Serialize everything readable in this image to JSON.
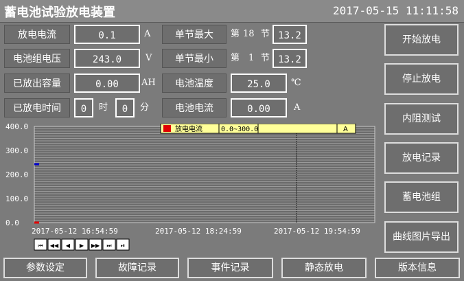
{
  "header": {
    "title": "蓄电池试验放电装置",
    "datetime": "2017-05-15 11:11:58"
  },
  "readings": {
    "discharge_current": {
      "label": "放电电流",
      "value": "0.1",
      "unit": "A"
    },
    "battery_voltage": {
      "label": "电池组电压",
      "value": "243.0",
      "unit": "V"
    },
    "discharged_capacity": {
      "label": "已放出容量",
      "value": "0.00",
      "unit": "AH"
    },
    "discharge_time": {
      "label": "已放电时间",
      "hours": "0",
      "hour_unit": "时",
      "minutes": "0",
      "minute_unit": "分"
    },
    "cell_max": {
      "label": "单节最大",
      "prefix": "第",
      "index": "18",
      "suffix": "节",
      "value": "13.2"
    },
    "cell_min": {
      "label": "单节最小",
      "prefix": "第",
      "index": "1",
      "suffix": "节",
      "value": "13.2"
    },
    "battery_temp": {
      "label": "电池温度",
      "value": "25.0",
      "unit": "℃"
    },
    "battery_current": {
      "label": "电池电流",
      "value": "0.00",
      "unit": "A"
    }
  },
  "side_buttons": [
    "开始放电",
    "停止放电",
    "内阻测试",
    "放电记录",
    "蓄电池组",
    "曲线图片导出"
  ],
  "bottom_tabs": [
    "参数设定",
    "故障记录",
    "事件记录",
    "静态放电",
    "版本信息"
  ],
  "chart_data": {
    "type": "line",
    "ylim": [
      0,
      400
    ],
    "y_ticks": [
      "400.0",
      "300.0",
      "200.0",
      "100.0",
      "0.0"
    ],
    "x_labels": [
      "2017-05-12 16:54:59",
      "2017-05-12 18:24:59",
      "2017-05-12 19:54:59"
    ],
    "legend": {
      "name": "放电电流",
      "range": "0.0~300.0",
      "unit": "A",
      "color": "#e00000"
    },
    "series": [
      {
        "name": "放电电流",
        "color": "#e00000",
        "points": [
          [
            0,
            0.1
          ]
        ]
      },
      {
        "color": "#0000d0",
        "points": [
          [
            0,
            243.0
          ]
        ]
      }
    ],
    "cursor_fraction": 0.77
  },
  "nav": {
    "icons": [
      "first-icon",
      "prev-fast-icon",
      "prev-icon",
      "next-icon",
      "next-fast-icon",
      "last-icon",
      "end-icon"
    ]
  }
}
